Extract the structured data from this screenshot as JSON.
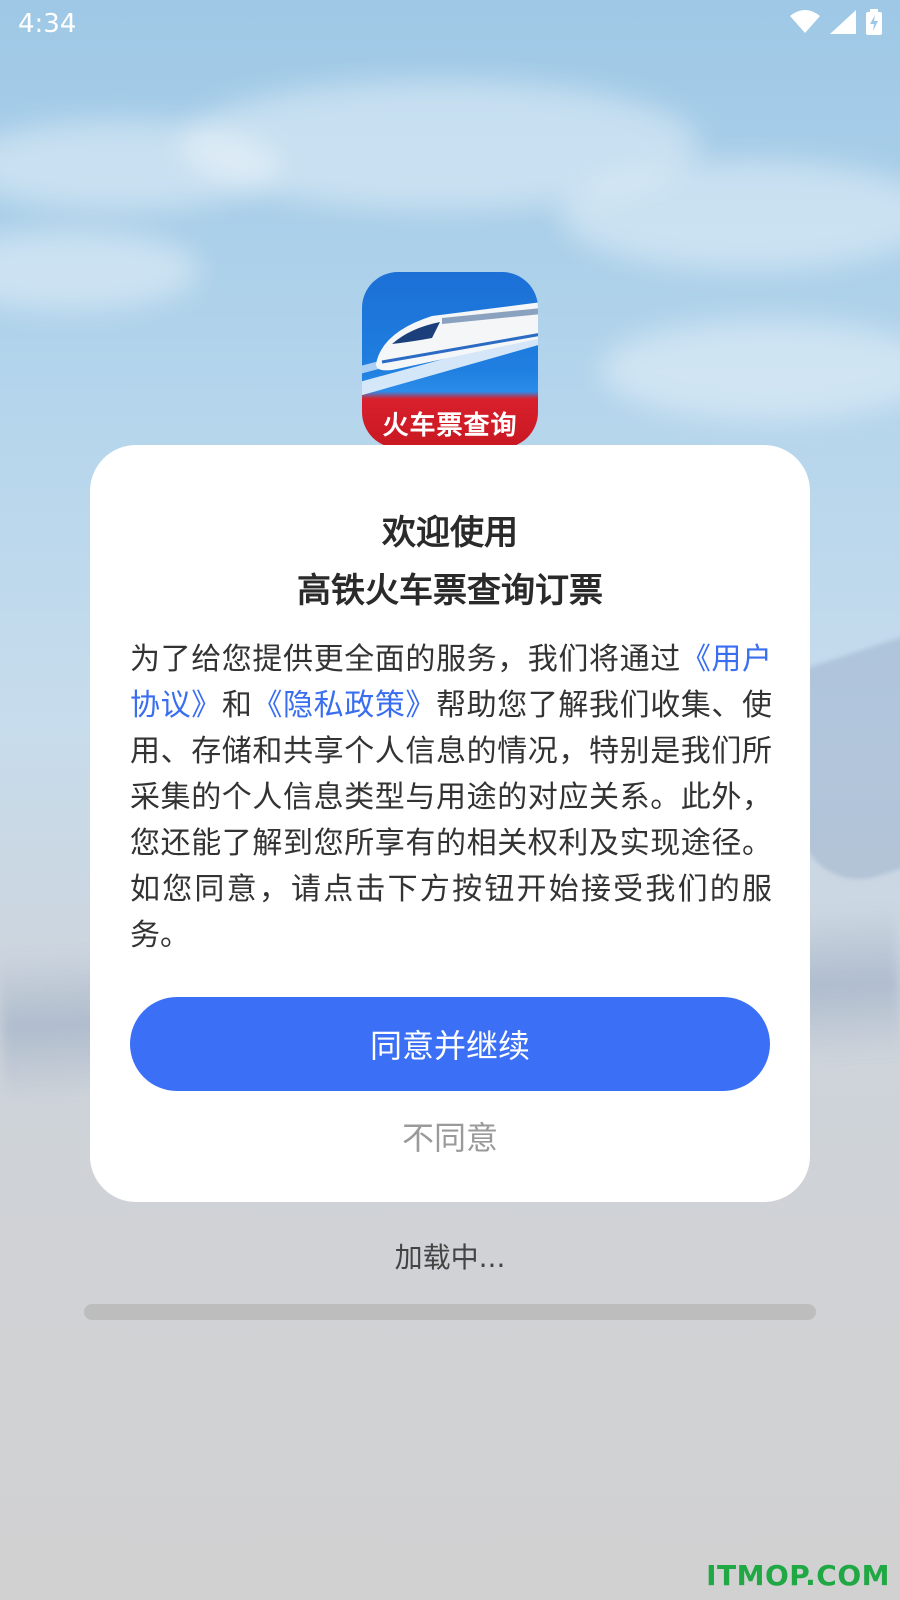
{
  "status_bar": {
    "time": "4:34",
    "icons": [
      "wifi-icon",
      "cellular-signal-icon",
      "battery-charging-icon"
    ]
  },
  "app_icon": {
    "label": "火车票查询"
  },
  "dialog": {
    "title_line1": "欢迎使用",
    "title_line2": "高铁火车票查询订票",
    "body_prefix": "为了给您提供更全面的服务，我们将通过",
    "user_agreement_link": "《用户协议》",
    "and_text": "和",
    "privacy_policy_link": "《隐私政策》",
    "body_suffix": "帮助您了解我们收集、使用、存储和共享个人信息的情况，特别是我们所采集的个人信息类型与用途的对应关系。此外，您还能了解到您所享有的相关权利及实现途径。如您同意，请点击下方按钮开始接受我们的服务。",
    "agree_label": "同意并继续",
    "disagree_label": "不同意"
  },
  "loading": {
    "text": "加载中...",
    "progress": 0
  },
  "watermark": "ITMOP.COM",
  "colors": {
    "accent": "#3b70f6",
    "link": "#3a6ef0",
    "watermark": "#1fa843"
  }
}
